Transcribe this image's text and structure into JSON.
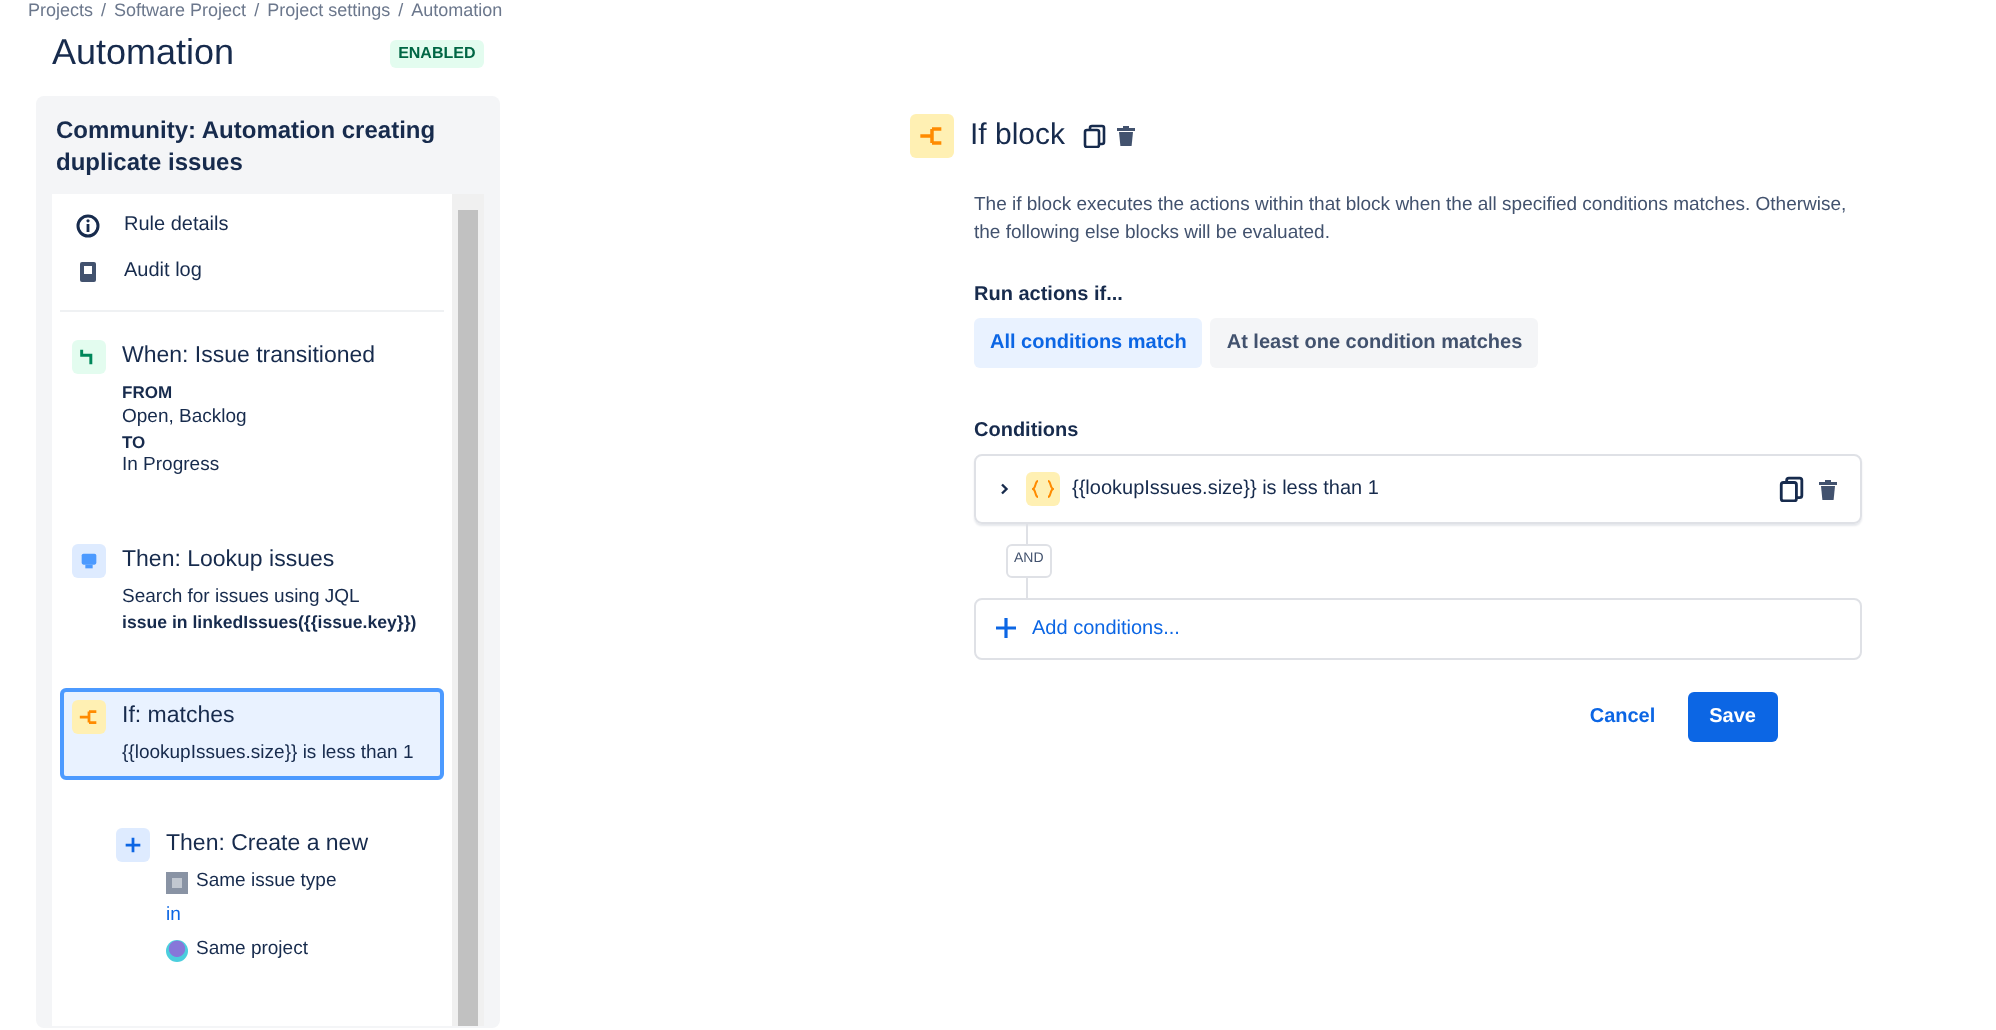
{
  "breadcrumbs": [
    "Projects",
    "Software Project",
    "Project settings",
    "Automation"
  ],
  "breadcrumb_separator": "/",
  "header": {
    "title": "Automation",
    "status": "ENABLED",
    "enabled": true
  },
  "rule": {
    "name": "Community: Automation creating duplicate issues",
    "menu": [
      {
        "kind": "info",
        "label": "Rule details"
      },
      {
        "kind": "log",
        "label": "Audit log"
      }
    ],
    "steps": [
      {
        "kind": "trigger",
        "title": "When: Issue transitioned",
        "selected": false,
        "lines": [
          {
            "kind": "heading",
            "text": "FROM"
          },
          {
            "kind": "text",
            "text": "Open, Backlog"
          },
          {
            "kind": "heading",
            "text": "TO"
          },
          {
            "kind": "text",
            "text": "In Progress"
          }
        ]
      },
      {
        "kind": "action",
        "title": "Then: Lookup issues",
        "selected": false,
        "lines": [
          {
            "kind": "text",
            "text": "Search for issues using JQL"
          },
          {
            "kind": "code",
            "text": "issue in linkedIssues({{issue.key}})"
          }
        ]
      },
      {
        "kind": "condition",
        "title": "If: matches",
        "selected": true,
        "lines": [
          {
            "kind": "text",
            "text": "{{lookupIssues.size}} is less than 1"
          }
        ],
        "children": [
          {
            "kind": "create",
            "title": "Then: Create a new",
            "selected": false,
            "lines": [
              {
                "kind": "issue-type",
                "text": "Same issue type"
              },
              {
                "kind": "link",
                "text": "in"
              },
              {
                "kind": "project",
                "text": "Same project"
              }
            ]
          }
        ]
      }
    ]
  },
  "editor": {
    "title": "If block",
    "description": "The if block executes the actions within that block when the all specified conditions matches. Otherwise, the following else blocks will be evaluated.",
    "run_label": "Run actions if...",
    "options": [
      {
        "label": "All conditions match",
        "selected": true
      },
      {
        "label": "At least one condition matches",
        "selected": false
      }
    ],
    "conditions_label": "Conditions",
    "conditions": [
      {
        "text": "{{lookupIssues.size}} is less than 1",
        "expanded": false
      }
    ],
    "joiner": "AND",
    "add_label": "Add conditions...",
    "buttons": [
      {
        "kind": "link",
        "label": "Cancel"
      },
      {
        "kind": "primary",
        "label": "Save"
      }
    ]
  }
}
